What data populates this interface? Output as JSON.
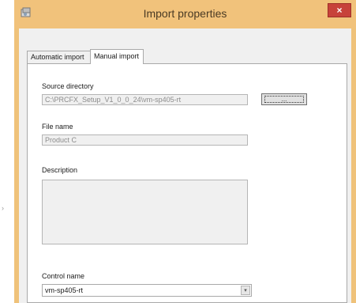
{
  "window": {
    "title": "Import properties",
    "close_label": "×",
    "app_icon": "app-window-icon"
  },
  "tabs": [
    {
      "label": "Automatic import",
      "active": false
    },
    {
      "label": "Manual import",
      "active": true
    }
  ],
  "form": {
    "source_directory_label": "Source directory",
    "source_directory_value": "C:\\PRCFX_Setup_V1_0_0_24\\vm-sp405-rt",
    "browse_label": "...",
    "file_name_label": "File name",
    "file_name_value": "Product C",
    "description_label": "Description",
    "description_value": "",
    "control_name_label": "Control name",
    "control_name_value": "vm-sp405-rt",
    "control_name_arrow": "▾"
  },
  "outside": {
    "side_arrow": "›"
  }
}
